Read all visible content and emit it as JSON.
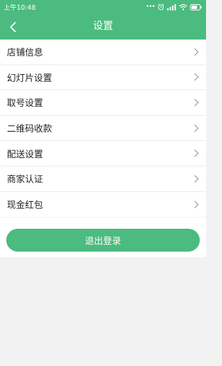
{
  "status_bar": {
    "time": "上午10:48",
    "icons": [
      "more-dots-icon",
      "alarm-icon",
      "signal-icon",
      "wifi-icon",
      "battery-icon"
    ]
  },
  "header": {
    "title": "设置",
    "back_icon": "chevron-left-icon"
  },
  "menu": {
    "items": [
      {
        "label": "店铺信息"
      },
      {
        "label": "幻灯片设置"
      },
      {
        "label": "取号设置"
      },
      {
        "label": "二维码收款"
      },
      {
        "label": "配送设置"
      },
      {
        "label": "商家认证"
      },
      {
        "label": "现金红包"
      }
    ]
  },
  "logout": {
    "label": "退出登录"
  },
  "colors": {
    "accent": "#4cbb7f",
    "background": "#f2f2f2"
  }
}
